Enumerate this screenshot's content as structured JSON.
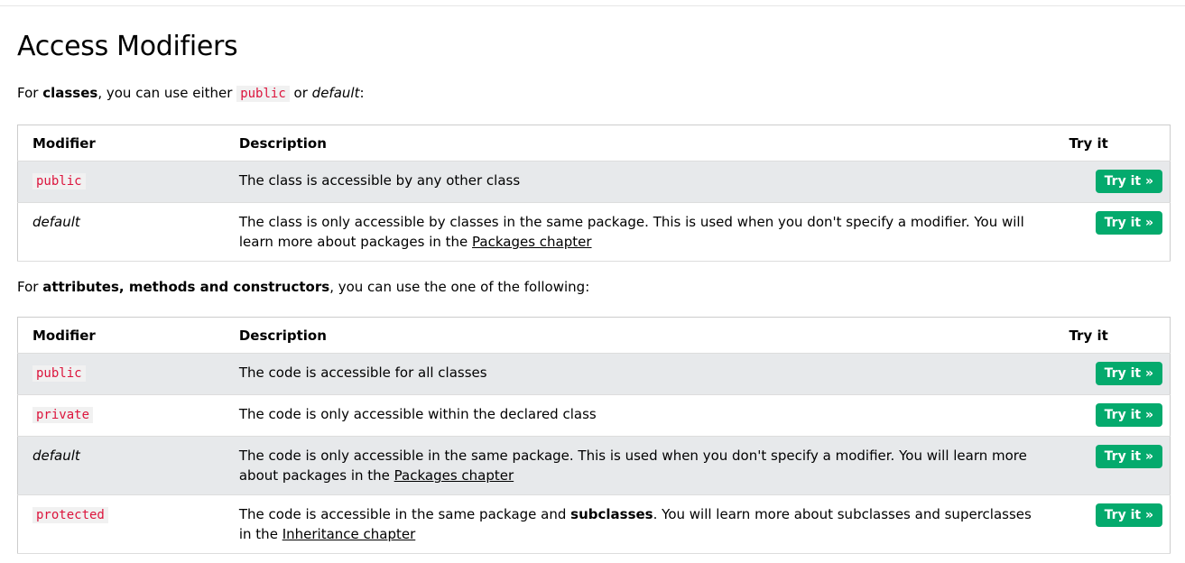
{
  "page_title": "Access Modifiers",
  "intro1": {
    "prefix": "For ",
    "bold": "classes",
    "middle": ", you can use either ",
    "code": "public",
    "or": " or ",
    "italic": "default",
    "suffix": ":"
  },
  "table1": {
    "headers": [
      "Modifier",
      "Description",
      "Try it"
    ],
    "rows": [
      {
        "modifier": "public",
        "description": "The class is accessible by any other class",
        "button": "Try it »"
      },
      {
        "modifier": "default",
        "description": "The class is only accessible by classes in the same package. This is used when you don't specify a modifier. You will learn more about packages in the ",
        "link": "Packages chapter",
        "button": "Try it »"
      }
    ]
  },
  "intro2": {
    "prefix": "For ",
    "bold": "attributes, methods and constructors",
    "suffix": ", you can use the one of the following:"
  },
  "table2": {
    "headers": [
      "Modifier",
      "Description",
      "Try it"
    ],
    "rows": [
      {
        "modifier": "public",
        "description": "The code is accessible for all classes",
        "button": "Try it »"
      },
      {
        "modifier": "private",
        "description": "The code is only accessible within the declared class",
        "button": "Try it »"
      },
      {
        "modifier": "default",
        "description": "The code is only accessible in the same package. This is used when you don't specify a modifier. You will learn more about packages in the ",
        "link": "Packages chapter",
        "button": "Try it »"
      },
      {
        "modifier": "protected",
        "description_pre": "The code is accessible in the same package and ",
        "description_bold": "subclasses",
        "description_post": ". You will learn more about subclasses and superclasses in the ",
        "link": "Inheritance chapter",
        "button": "Try it »"
      }
    ]
  },
  "colors": {
    "button_bg": "#04aa6d",
    "keyword": "#dc143c",
    "shaded_row": "#e7e9eb"
  }
}
